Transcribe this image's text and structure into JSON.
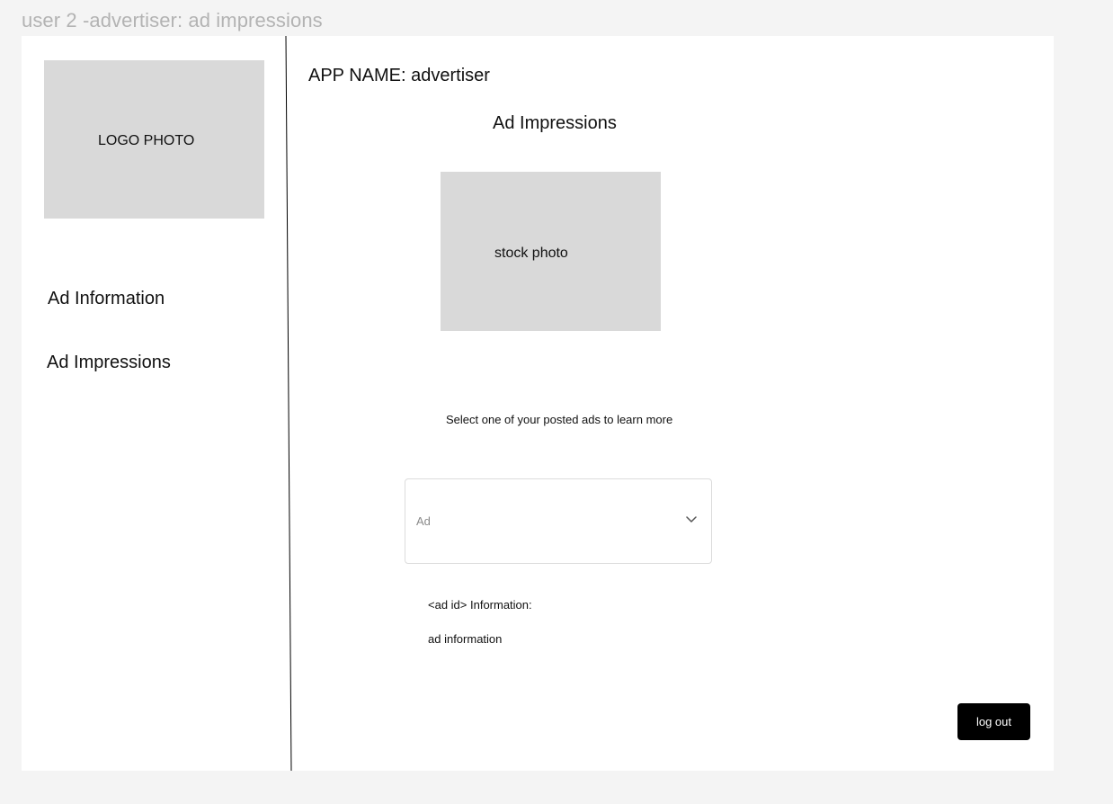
{
  "frame": {
    "title": "user 2 -advertiser: ad impressions"
  },
  "sidebar": {
    "logo_label": "LOGO PHOTO",
    "items": [
      {
        "label": "Ad Information"
      },
      {
        "label": "Ad Impressions"
      }
    ]
  },
  "main": {
    "app_name": "APP NAME: advertiser",
    "page_title": "Ad Impressions",
    "stock_photo_label": "stock photo",
    "prompt": "Select one of your posted ads to learn more",
    "ad_select": {
      "placeholder": "Ad",
      "icon": "chevron-down-icon"
    },
    "info_label": "<ad id> Information:",
    "info_value": "ad information",
    "logout_label": "log out"
  },
  "colors": {
    "background": "#f4f4f4",
    "frame": "#ffffff",
    "placeholder_box": "#d9d9d9",
    "button": "#000000",
    "button_text": "#ffffff",
    "frame_title": "#b3b3b3"
  }
}
